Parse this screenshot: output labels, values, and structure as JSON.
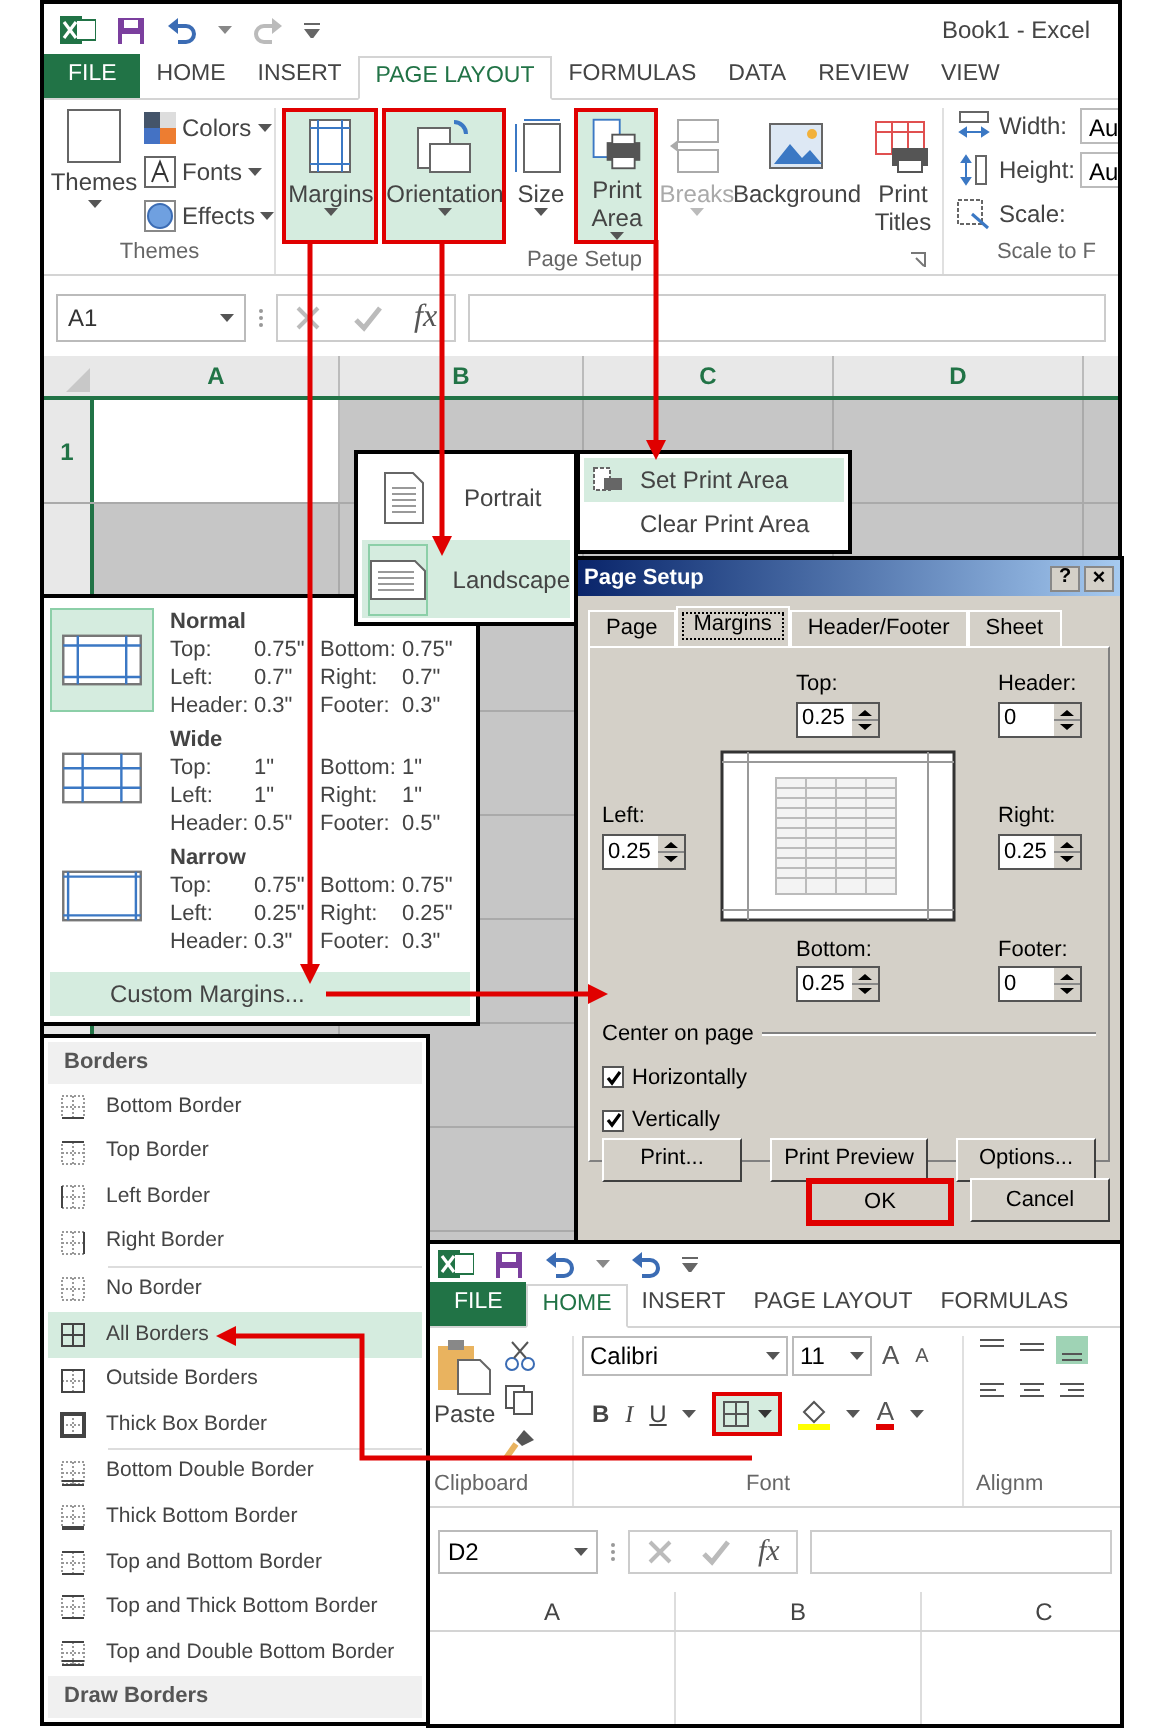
{
  "top_window": {
    "title": "Book1 - Excel",
    "tabs": [
      {
        "label": "FILE",
        "kind": "file"
      },
      {
        "label": "HOME",
        "kind": "tab",
        "selected": false
      },
      {
        "label": "INSERT",
        "kind": "tab",
        "selected": false
      },
      {
        "label": "PAGE LAYOUT",
        "kind": "tab",
        "selected": true
      },
      {
        "label": "FORMULAS",
        "kind": "tab",
        "selected": false
      },
      {
        "label": "DATA",
        "kind": "tab",
        "selected": false
      },
      {
        "label": "REVIEW",
        "kind": "tab",
        "selected": false
      },
      {
        "label": "VIEW",
        "kind": "tab",
        "selected": false
      }
    ],
    "themes_group": {
      "label": "Themes",
      "themes_button": "Themes",
      "items": [
        {
          "label": "Colors",
          "kind": "colors"
        },
        {
          "label": "Fonts",
          "kind": "fonts"
        },
        {
          "label": "Effects",
          "kind": "effects"
        }
      ]
    },
    "page_setup_group": {
      "label": "Page Setup",
      "buttons": [
        {
          "label": "Margins",
          "kind": "margins",
          "highlighted": true,
          "disabled": false
        },
        {
          "label": "Orientation",
          "kind": "orientation",
          "highlighted": true,
          "disabled": false
        },
        {
          "label": "Size",
          "kind": "size",
          "highlighted": false,
          "disabled": false
        },
        {
          "label": "Print Area",
          "kind": "printarea",
          "highlighted": true,
          "disabled": false
        },
        {
          "label": "Breaks",
          "kind": "breaks",
          "highlighted": false,
          "disabled": true
        },
        {
          "label": "Background",
          "kind": "background",
          "highlighted": false,
          "disabled": false
        },
        {
          "label": "Print Titles",
          "kind": "titles",
          "highlighted": false,
          "disabled": false
        }
      ]
    },
    "scale_group": {
      "label": "Scale to F",
      "fields": [
        {
          "label": "Width:",
          "kind": "width",
          "value": "Au"
        },
        {
          "label": "Height:",
          "kind": "height",
          "value": "Au"
        },
        {
          "label": "Scale:",
          "kind": "scale"
        }
      ]
    },
    "name_box": "A1",
    "function_label": "fx",
    "columns": [
      "A",
      "B",
      "C",
      "D"
    ],
    "rows": [
      "1"
    ]
  },
  "orientation_menu": {
    "items": [
      {
        "label": "Portrait",
        "kind": "portrait",
        "selected": false
      },
      {
        "label": "Landscape",
        "kind": "landscape",
        "selected": true
      }
    ]
  },
  "print_area_menu": {
    "items": [
      {
        "label": "Set Print Area",
        "kind": "set",
        "selected": true
      },
      {
        "label": "Clear Print Area",
        "kind": "clear",
        "selected": false
      }
    ]
  },
  "margins_menu": {
    "presets": [
      {
        "name": "Normal",
        "kind": "normal",
        "selected": true,
        "rows": [
          [
            "Top:",
            "0.75\"",
            "Bottom:",
            "0.75\""
          ],
          [
            "Left:",
            "0.7\"",
            "Right:",
            "0.7\""
          ],
          [
            "Header:",
            "0.3\"",
            "Footer:",
            "0.3\""
          ]
        ]
      },
      {
        "name": "Wide",
        "kind": "wide",
        "selected": false,
        "rows": [
          [
            "Top:",
            "1\"",
            "Bottom:",
            "1\""
          ],
          [
            "Left:",
            "1\"",
            "Right:",
            "1\""
          ],
          [
            "Header:",
            "0.5\"",
            "Footer:",
            "0.5\""
          ]
        ]
      },
      {
        "name": "Narrow",
        "kind": "narrow",
        "selected": false,
        "rows": [
          [
            "Top:",
            "0.75\"",
            "Bottom:",
            "0.75\""
          ],
          [
            "Left:",
            "0.25\"",
            "Right:",
            "0.25\""
          ],
          [
            "Header:",
            "0.3\"",
            "Footer:",
            "0.3\""
          ]
        ]
      }
    ],
    "custom": "Custom Margins..."
  },
  "page_setup_dialog": {
    "title": "Page Setup",
    "help": "?",
    "close": "×",
    "tabs": [
      {
        "label": "Page",
        "selected": false
      },
      {
        "label": "Margins",
        "selected": true
      },
      {
        "label": "Header/Footer",
        "selected": false
      },
      {
        "label": "Sheet",
        "selected": false
      }
    ],
    "spinners": [
      {
        "label": "Top:",
        "value": "0.25"
      },
      {
        "label": "Header:",
        "value": "0"
      },
      {
        "label": "Left:",
        "value": "0.25"
      },
      {
        "label": "Right:",
        "value": "0.25"
      },
      {
        "label": "Bottom:",
        "value": "0.25"
      },
      {
        "label": "Footer:",
        "value": "0"
      }
    ],
    "center_group": "Center on page",
    "checks": [
      {
        "label": "Horizontally",
        "checked": true
      },
      {
        "label": "Vertically",
        "checked": true
      }
    ],
    "buttons": [
      "Print...",
      "Print Preview",
      "Options..."
    ],
    "ok": {
      "label": "OK",
      "highlighted": true
    },
    "cancel": "Cancel"
  },
  "borders_menu": {
    "title": "Borders",
    "groups": [
      [
        {
          "label": "Bottom Border",
          "kind": "bottom",
          "selected": false
        },
        {
          "label": "Top Border",
          "kind": "top",
          "selected": false
        },
        {
          "label": "Left Border",
          "kind": "left",
          "selected": false
        },
        {
          "label": "Right Border",
          "kind": "right",
          "selected": false
        }
      ],
      [
        {
          "label": "No Border",
          "kind": "none",
          "selected": false
        },
        {
          "label": "All Borders",
          "kind": "all",
          "selected": true
        },
        {
          "label": "Outside Borders",
          "kind": "outside",
          "selected": false
        },
        {
          "label": "Thick Box Border",
          "kind": "thickbox",
          "selected": false
        }
      ],
      [
        {
          "label": "Bottom Double Border",
          "kind": "bottomdouble",
          "selected": false
        },
        {
          "label": "Thick Bottom Border",
          "kind": "thickbottom",
          "selected": false
        },
        {
          "label": "Top and Bottom Border",
          "kind": "topbottom",
          "selected": false
        },
        {
          "label": "Top and Thick Bottom Border",
          "kind": "topthickbottom",
          "selected": false
        },
        {
          "label": "Top and Double Bottom Border",
          "kind": "topdoublebottom",
          "selected": false
        }
      ]
    ],
    "footer": "Draw Borders"
  },
  "bottom_window": {
    "tabs": [
      {
        "label": "FILE",
        "kind": "file"
      },
      {
        "label": "HOME",
        "kind": "tab",
        "selected": true
      },
      {
        "label": "INSERT",
        "kind": "tab",
        "selected": false
      },
      {
        "label": "PAGE LAYOUT",
        "kind": "tab",
        "selected": false
      },
      {
        "label": "FORMULAS",
        "kind": "tab",
        "selected": false
      }
    ],
    "clipboard": {
      "label": "Clipboard",
      "paste": "Paste"
    },
    "font": {
      "label": "Font",
      "name": "Calibri",
      "size": "11",
      "grow": "A",
      "shrink": "A",
      "styles": [
        "B",
        "I",
        "U"
      ],
      "font_color": "A",
      "borders_highlighted": true
    },
    "alignment_label": "Alignm",
    "name_box": "D2",
    "function_label": "fx",
    "columns": [
      "A",
      "B",
      "C"
    ]
  }
}
